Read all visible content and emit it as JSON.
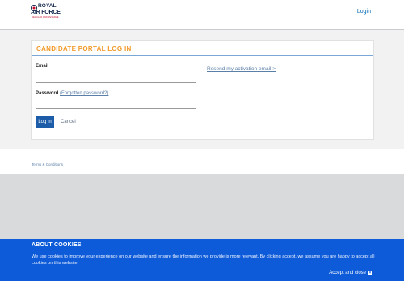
{
  "header": {
    "logo": {
      "line1": "ROYAL",
      "line2": "AIR FORCE",
      "line3": "REGULAR AND RESERVE"
    },
    "login_link": "Login"
  },
  "panel": {
    "title": "CANDIDATE PORTAL LOG IN",
    "email_label": "Email",
    "email_value": "",
    "password_label": "Password",
    "forgotten_password": "(Forgotten password?)",
    "password_value": "",
    "login_button": "Log in",
    "cancel_link": "Cancel",
    "resend_link": "Resend my activation email >"
  },
  "footer": {
    "terms_link": "Terms & Conditions"
  },
  "cookie_banner": {
    "title": "ABOUT COOKIES",
    "text": "We use cookies to improve your experience on our website and ensure the information we provide is more relevant. By clicking accept, we assume you are happy to accept all cookies on this website.",
    "accept_label": "Accept and close"
  },
  "colors": {
    "accent_orange": "#f29b2c",
    "primary_blue": "#1d5ca8",
    "cookie_blue": "#0d5bd8",
    "link_blue": "#0066b3"
  }
}
